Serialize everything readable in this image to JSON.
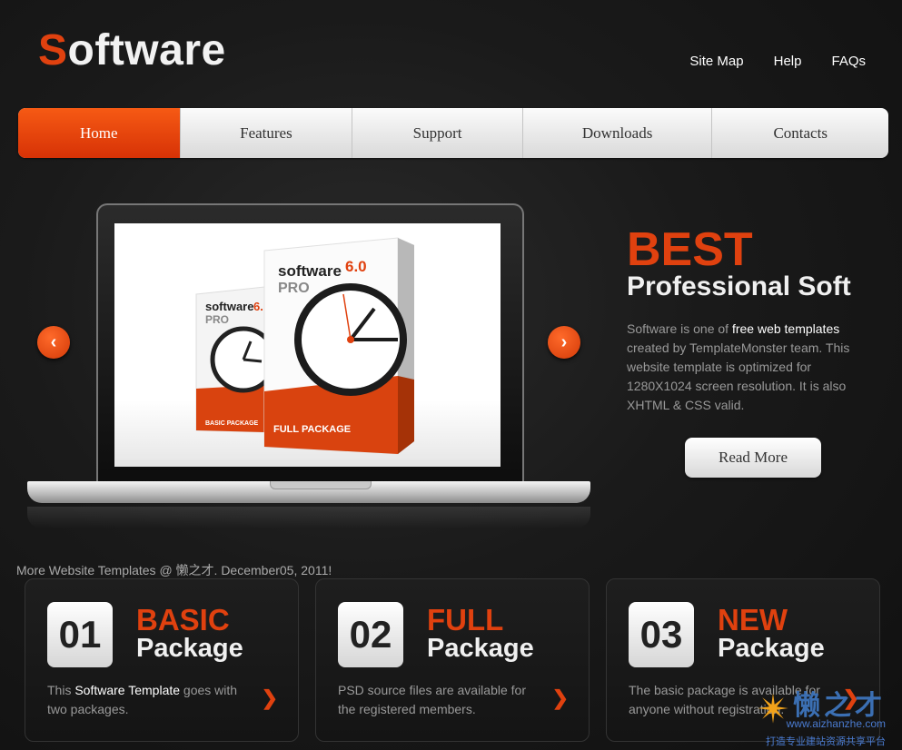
{
  "header": {
    "logo_first": "S",
    "logo_rest": "oftware",
    "links": [
      "Site Map",
      "Help",
      "FAQs"
    ]
  },
  "nav": {
    "items": [
      "Home",
      "Features",
      "Support",
      "Downloads",
      "Contacts"
    ],
    "active": "Home"
  },
  "slider": {
    "prev_icon": "chevron-left-icon",
    "next_icon": "chevron-right-icon",
    "image": {
      "box_front_title": "software",
      "box_front_version": "6.0",
      "box_front_edition": "PRO",
      "box_front_label": "FULL PACKAGE",
      "box_back_title": "software",
      "box_back_version": "6.",
      "box_back_edition": "PRO",
      "box_back_label": "BASIC PACKAGE"
    }
  },
  "promo": {
    "heading": "BEST",
    "subheading": "Professional Soft",
    "desc_before": "Software is one of ",
    "desc_highlight": "free web templates",
    "desc_after": " created by TemplateMonster team. This website template is optimized for 1280X1024 screen resolution. It is also XHTML & CSS valid.",
    "button": "Read More"
  },
  "more_templates": "More Website Templates @ 懒之才. December05, 2011!",
  "packages": [
    {
      "num": "01",
      "title1": "BASIC",
      "title2": "Package",
      "desc_before": "This ",
      "desc_highlight": "Software Template",
      "desc_after": " goes with two packages."
    },
    {
      "num": "02",
      "title1": "FULL",
      "title2": "Package",
      "desc_before": "PSD source files are available for the registered members.",
      "desc_highlight": "",
      "desc_after": ""
    },
    {
      "num": "03",
      "title1": "NEW",
      "title2": "Package",
      "desc_before": "The basic package is available for anyone without registration.",
      "desc_highlight": "",
      "desc_after": ""
    }
  ],
  "watermark": {
    "cn": "懒之才",
    "url": "www.aizhanzhe.com",
    "slogan": "打造专业建站资源共享平台"
  },
  "colors": {
    "accent": "#e0410f",
    "background": "#1a1a1a",
    "nav_bg": "#ececec"
  }
}
